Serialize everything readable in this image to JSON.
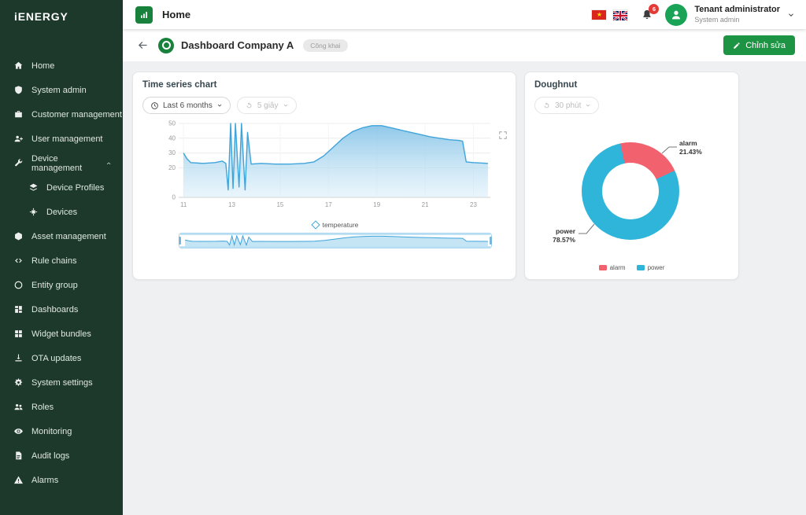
{
  "brand": {
    "logo_text": "iENERGY"
  },
  "topbar": {
    "title": "Home",
    "notification_count": "6",
    "user_name": "Tenant administrator",
    "user_role": "System admin"
  },
  "sidebar": {
    "items": [
      {
        "label": "Home",
        "icon": "home"
      },
      {
        "label": "System admin",
        "icon": "shield"
      },
      {
        "label": "Customer management",
        "icon": "briefcase"
      },
      {
        "label": "User management",
        "icon": "user-add"
      },
      {
        "label": "Device management",
        "icon": "wrench",
        "expanded": true,
        "children": [
          {
            "label": "Device Profiles",
            "icon": "layers"
          },
          {
            "label": "Devices",
            "icon": "chip"
          }
        ]
      },
      {
        "label": "Asset management",
        "icon": "cube"
      },
      {
        "label": "Rule chains",
        "icon": "code"
      },
      {
        "label": "Entity group",
        "icon": "globe"
      },
      {
        "label": "Dashboards",
        "icon": "dashboard"
      },
      {
        "label": "Widget bundles",
        "icon": "widgets"
      },
      {
        "label": "OTA updates",
        "icon": "download"
      },
      {
        "label": "System settings",
        "icon": "gear"
      },
      {
        "label": "Roles",
        "icon": "roles"
      },
      {
        "label": "Monitoring",
        "icon": "eye"
      },
      {
        "label": "Audit logs",
        "icon": "document"
      },
      {
        "label": "Alarms",
        "icon": "warning"
      }
    ]
  },
  "page_header": {
    "title": "Dashboard Company A",
    "visibility_badge": "Công khai",
    "edit_button_label": "Chỉnh sửa"
  },
  "cards": {
    "timeseries": {
      "range_label": "Last 6 months",
      "interval_label": "5 giây"
    },
    "doughnut": {
      "interval_label": "30 phút"
    }
  },
  "chart_data": [
    {
      "type": "area",
      "title": "Time series chart",
      "xlabel": "",
      "ylabel": "",
      "xlim": [
        10.8,
        23.7
      ],
      "ylim": [
        0,
        50
      ],
      "xticks": [
        11,
        13,
        15,
        17,
        19,
        21,
        23
      ],
      "yticks": [
        0,
        20,
        30,
        40,
        50
      ],
      "grid": true,
      "legend_position": "bottom",
      "color": "#3ea4da",
      "series": [
        {
          "name": "temperature",
          "points": [
            [
              11,
              30
            ],
            [
              11.15,
              26
            ],
            [
              11.3,
              23.5
            ],
            [
              11.8,
              23
            ],
            [
              12.3,
              23.5
            ],
            [
              12.6,
              24.5
            ],
            [
              12.75,
              23
            ],
            [
              12.85,
              5
            ],
            [
              12.95,
              50
            ],
            [
              13.05,
              6
            ],
            [
              13.15,
              50
            ],
            [
              13.3,
              7
            ],
            [
              13.4,
              50
            ],
            [
              13.55,
              5
            ],
            [
              13.65,
              44
            ],
            [
              13.8,
              22.5
            ],
            [
              14.2,
              23
            ],
            [
              14.8,
              22.5
            ],
            [
              15.4,
              22.5
            ],
            [
              16,
              23
            ],
            [
              16.4,
              24
            ],
            [
              16.8,
              28
            ],
            [
              17.2,
              34
            ],
            [
              17.6,
              40
            ],
            [
              18,
              44.5
            ],
            [
              18.4,
              47
            ],
            [
              18.8,
              48.5
            ],
            [
              19.2,
              48.5
            ],
            [
              19.6,
              47
            ],
            [
              20,
              45.5
            ],
            [
              20.4,
              44
            ],
            [
              20.8,
              42.5
            ],
            [
              21.2,
              41
            ],
            [
              21.6,
              40
            ],
            [
              22,
              39
            ],
            [
              22.4,
              38.5
            ],
            [
              22.55,
              38
            ],
            [
              22.7,
              24
            ],
            [
              23,
              23.5
            ],
            [
              23.6,
              23
            ]
          ]
        }
      ]
    },
    {
      "type": "doughnut",
      "title": "Doughnut",
      "legend_position": "bottom",
      "slices": [
        {
          "name": "alarm",
          "pct": 21.43,
          "pct_label": "21.43%",
          "color": "#f2616e"
        },
        {
          "name": "power",
          "pct": 78.57,
          "pct_label": "78.57%",
          "color": "#2fb5d9"
        }
      ]
    }
  ]
}
